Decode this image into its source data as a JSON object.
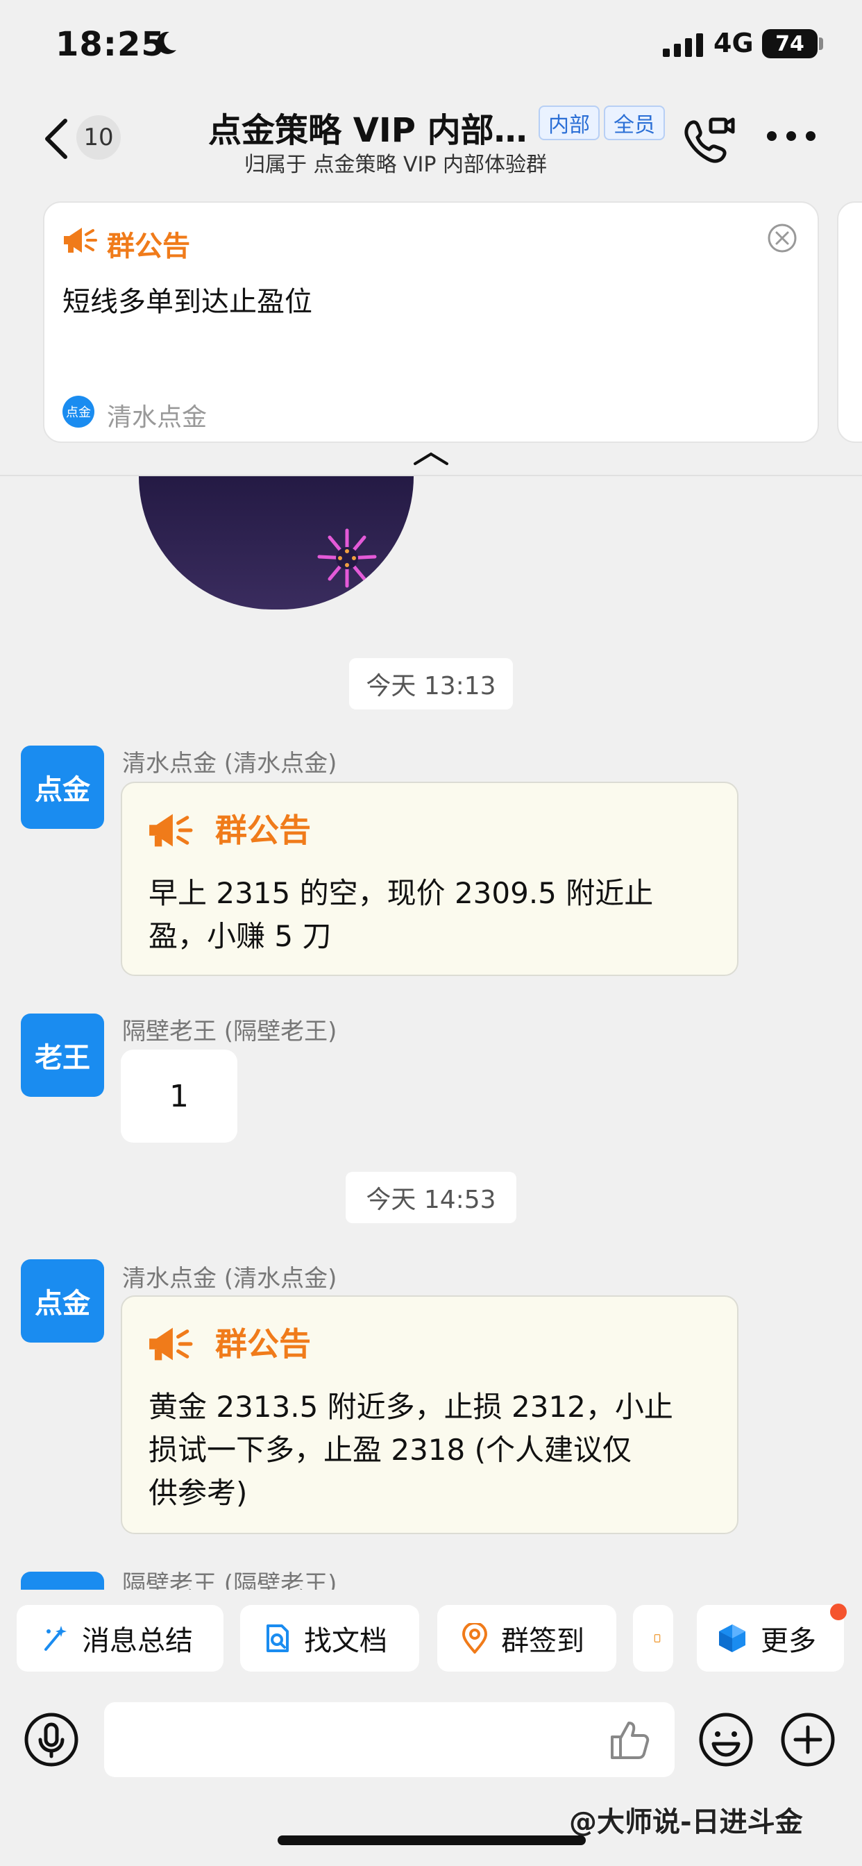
{
  "status_bar": {
    "time": "18:25",
    "network": "4G",
    "battery": "74"
  },
  "header": {
    "unread_count": "10",
    "title": "点金策略 VIP 内部…",
    "tags": [
      "内部",
      "全员"
    ],
    "subtitle": "归属于 点金策略 VIP 内部体验群"
  },
  "announcement": {
    "label": "群公告",
    "text": "短线多单到达止盈位",
    "author_avatar": "点金",
    "author": "清水点金"
  },
  "messages": {
    "ts1": "今天 13:13",
    "m1": {
      "avatar": "点金",
      "sender": "清水点金 (清水点金)",
      "notice_label": "群公告",
      "body": [
        "早上 2315 的空，现价 2309.5 附近止",
        "盈，小赚 5 刀"
      ]
    },
    "m2": {
      "avatar": "老王",
      "sender": "隔壁老王 (隔壁老王)",
      "text": "1"
    },
    "ts2": "今天 14:53",
    "m3": {
      "avatar": "点金",
      "sender": "清水点金 (清水点金)",
      "notice_label": "群公告",
      "body": [
        "黄金 2313.5 附近多，止损 2312，小止",
        "损试一下多，止盈 2318 (个人建议仅",
        "供参考)"
      ]
    },
    "m4": {
      "sender": "隔壁老王 (隔壁老王)"
    }
  },
  "toolbar": {
    "summary": "消息总结",
    "find_doc": "找文档",
    "checkin": "群签到",
    "more": "更多"
  },
  "input": {
    "placeholder": ""
  },
  "watermark": "@大师说-日进斗金",
  "colors": {
    "accent_orange": "#f07b1a",
    "avatar_blue": "#1a8cf0",
    "notice_bg": "#fbfaee"
  },
  "icons": [
    "moon-icon",
    "signal-icon",
    "back-chevron-icon",
    "video-call-icon",
    "more-dots-icon",
    "megaphone-icon",
    "close-circle-icon",
    "collapse-chevron-icon",
    "sparkle-icon",
    "doc-search-icon",
    "location-pin-icon",
    "cube-icon",
    "microphone-icon",
    "thumbs-up-icon",
    "emoji-icon",
    "plus-circle-icon"
  ]
}
